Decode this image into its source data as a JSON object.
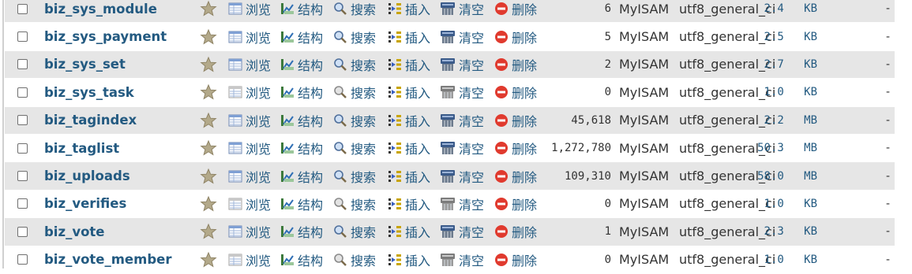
{
  "actions": {
    "browse": "浏览",
    "structure": "结构",
    "search": "搜索",
    "insert": "插入",
    "empty": "清空",
    "drop": "删除"
  },
  "rows": [
    {
      "name": "biz_sys_module",
      "rows": "6",
      "engine": "MyISAM",
      "collation": "utf8_general_ci",
      "size": "2.4",
      "unit": "KB",
      "overhead": "-",
      "browse_enabled": true
    },
    {
      "name": "biz_sys_payment",
      "rows": "5",
      "engine": "MyISAM",
      "collation": "utf8_general_ci",
      "size": "2.5",
      "unit": "KB",
      "overhead": "-",
      "browse_enabled": true
    },
    {
      "name": "biz_sys_set",
      "rows": "2",
      "engine": "MyISAM",
      "collation": "utf8_general_ci",
      "size": "2.7",
      "unit": "KB",
      "overhead": "-",
      "browse_enabled": true
    },
    {
      "name": "biz_sys_task",
      "rows": "0",
      "engine": "MyISAM",
      "collation": "utf8_general_ci",
      "size": "1.0",
      "unit": "KB",
      "overhead": "-",
      "browse_enabled": false
    },
    {
      "name": "biz_tagindex",
      "rows": "45,618",
      "engine": "MyISAM",
      "collation": "utf8_general_ci",
      "size": "2.2",
      "unit": "MB",
      "overhead": "-",
      "browse_enabled": true
    },
    {
      "name": "biz_taglist",
      "rows": "1,272,780",
      "engine": "MyISAM",
      "collation": "utf8_general_ci",
      "size": "50.3",
      "unit": "MB",
      "overhead": "-",
      "browse_enabled": true
    },
    {
      "name": "biz_uploads",
      "rows": "109,310",
      "engine": "MyISAM",
      "collation": "utf8_general_ci",
      "size": "58.0",
      "unit": "MB",
      "overhead": "-",
      "browse_enabled": true
    },
    {
      "name": "biz_verifies",
      "rows": "0",
      "engine": "MyISAM",
      "collation": "utf8_general_ci",
      "size": "1.0",
      "unit": "KB",
      "overhead": "-",
      "browse_enabled": false
    },
    {
      "name": "biz_vote",
      "rows": "1",
      "engine": "MyISAM",
      "collation": "utf8_general_ci",
      "size": "2.3",
      "unit": "KB",
      "overhead": "-",
      "browse_enabled": true
    },
    {
      "name": "biz_vote_member",
      "rows": "0",
      "engine": "MyISAM",
      "collation": "utf8_general_ci",
      "size": "1.0",
      "unit": "KB",
      "overhead": "-",
      "browse_enabled": false
    }
  ]
}
